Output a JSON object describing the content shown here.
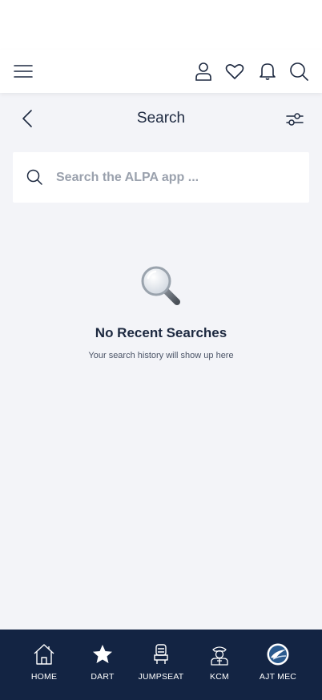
{
  "top_bar": {
    "icons": [
      "menu-icon",
      "profile-icon",
      "heart-icon",
      "bell-icon",
      "search-icon"
    ]
  },
  "header": {
    "title": "Search"
  },
  "search": {
    "placeholder": "Search the ALPA app ...",
    "value": ""
  },
  "empty_state": {
    "title": "No Recent Searches",
    "subtitle": "Your search history will show up here"
  },
  "bottom_nav": {
    "items": [
      {
        "label": "HOME",
        "icon": "home-icon"
      },
      {
        "label": "DART",
        "icon": "star-icon"
      },
      {
        "label": "JUMPSEAT",
        "icon": "jumpseat-icon"
      },
      {
        "label": "KCM",
        "icon": "pilot-icon"
      },
      {
        "label": "AJT MEC",
        "icon": "ajt-mec-logo-icon"
      }
    ]
  },
  "colors": {
    "background": "#f3f4f8",
    "nav_background": "#132443",
    "text_primary": "#1d2940",
    "placeholder": "#9aa1ad"
  }
}
